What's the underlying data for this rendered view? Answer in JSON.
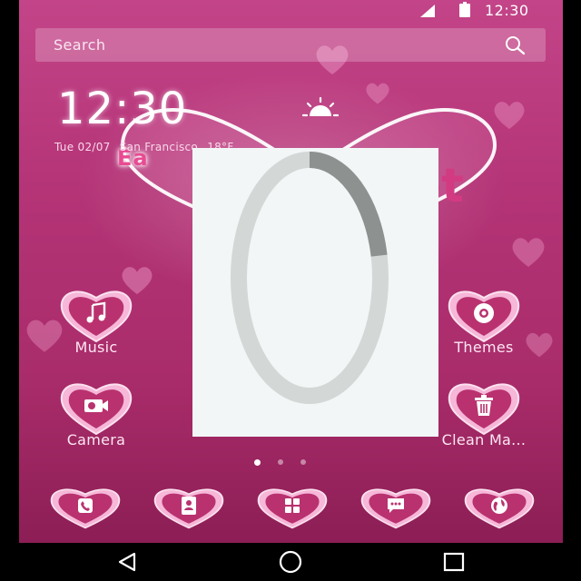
{
  "status_bar": {
    "time": "12:30"
  },
  "search": {
    "placeholder": "Search"
  },
  "clock_widget": {
    "time": "12:30",
    "date": "Tue  02/07",
    "location": "San Francisco",
    "temperature": "18°F"
  },
  "wallpaper": {
    "text_left": "Ea",
    "text_right": "et"
  },
  "apps": [
    {
      "label": "Music",
      "icon": "music-icon"
    },
    {
      "label": "Themes",
      "icon": "themes-icon"
    },
    {
      "label": "Camera",
      "icon": "camera-icon"
    },
    {
      "label": "Clean Ma...",
      "icon": "trash-icon"
    }
  ],
  "pager": {
    "pages": 3,
    "current": 1
  },
  "dock": [
    {
      "icon": "phone-icon"
    },
    {
      "icon": "contacts-icon"
    },
    {
      "icon": "app-drawer-icon"
    },
    {
      "icon": "messages-icon"
    },
    {
      "icon": "browser-icon"
    }
  ],
  "loading": {
    "progress": 0.22
  },
  "colors": {
    "accent": "#c34488",
    "heart": "#f6b2d6"
  }
}
